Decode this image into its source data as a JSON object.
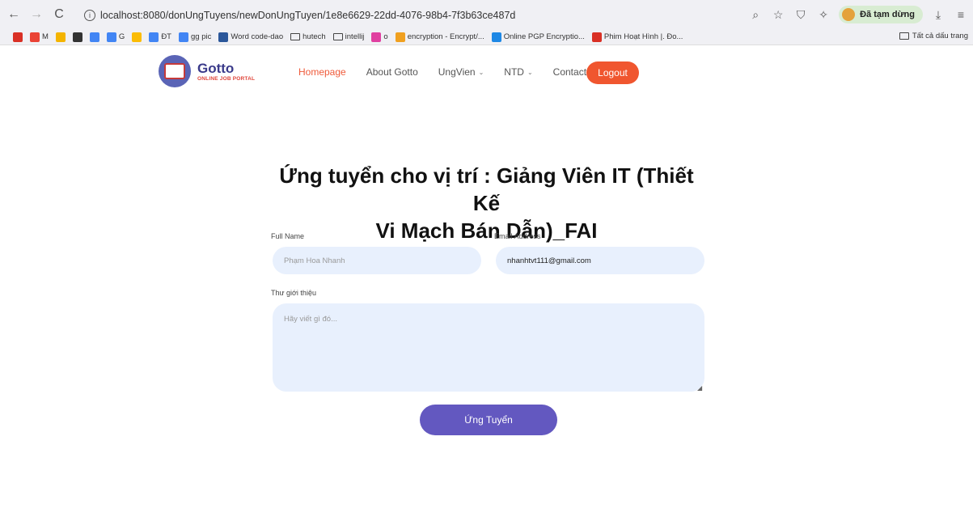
{
  "browser": {
    "url": "localhost:8080/donUngTuyens/newDonUngTuyen/1e8e6629-22dd-4076-98b4-7f3b63ce487d",
    "paused_label": "Đã tạm dừng",
    "all_bookmarks": "Tất cả dấu trang"
  },
  "bookmarks": [
    {
      "label": "",
      "color": "#d93025"
    },
    {
      "label": "M",
      "color": "#ea4335"
    },
    {
      "label": "",
      "color": "#f4b400"
    },
    {
      "label": "",
      "color": "#333333"
    },
    {
      "label": "",
      "color": "#4285f4"
    },
    {
      "label": "G",
      "color": "#4285f4"
    },
    {
      "label": "",
      "color": "#fbbc05"
    },
    {
      "label": "ĐT",
      "color": "#4285f4"
    },
    {
      "label": "gg pic",
      "color": "#4285f4"
    },
    {
      "label": "Word code-dao",
      "color": "#2b579a"
    },
    {
      "label": "hutech",
      "color": "folder"
    },
    {
      "label": "intellij",
      "color": "folder"
    },
    {
      "label": "o",
      "color": "#e040a0"
    },
    {
      "label": "encryption - Encrypt/...",
      "color": "#f0a020"
    },
    {
      "label": "Online PGP Encryptio...",
      "color": "#1e88e5"
    },
    {
      "label": "Phim Hoạt Hình |. Đo...",
      "color": "#d93025"
    }
  ],
  "header": {
    "logo_title": "Gotto",
    "logo_subtitle": "ONLINE JOB PORTAL",
    "menu": [
      {
        "label": "Homepage",
        "active": true,
        "dropdown": false
      },
      {
        "label": "About Gotto",
        "active": false,
        "dropdown": false
      },
      {
        "label": "UngVien",
        "active": false,
        "dropdown": true
      },
      {
        "label": "NTD",
        "active": false,
        "dropdown": true
      },
      {
        "label": "Contact",
        "active": false,
        "dropdown": false
      }
    ],
    "logout": "Logout"
  },
  "form": {
    "title_line1": "Ứng tuyển cho vị trí : Giảng Viên IT (Thiết Kế",
    "title_line2": "Vi Mạch Bán Dẫn)_FAI",
    "full_name_label": "Full Name",
    "full_name_placeholder": "Phạm Hoa Nhanh",
    "email_label": "Email Address",
    "email_value": "nhanhtvt111@gmail.com",
    "letter_label": "Thư giới thiệu",
    "letter_placeholder": "Hãy viết gì đó...",
    "submit": "Ứng Tuyển"
  }
}
